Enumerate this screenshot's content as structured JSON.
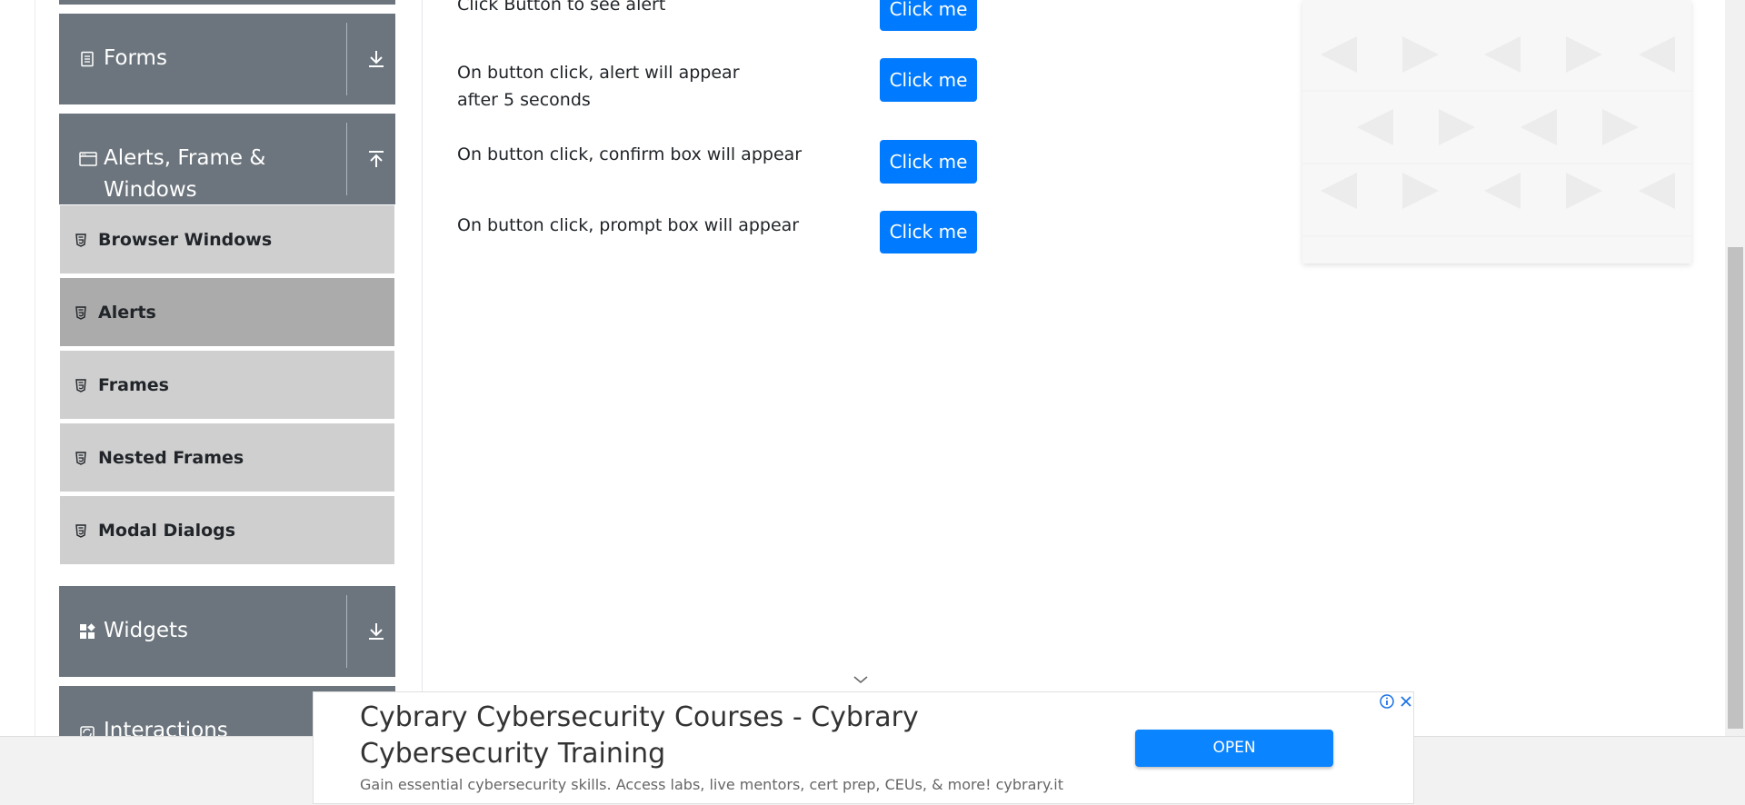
{
  "sidebar": {
    "groups": [
      {
        "label": "Forms",
        "icon": "document-icon",
        "toggle": "download-arrow-icon"
      },
      {
        "label": "Alerts, Frame & Windows",
        "icon": "window-icon",
        "toggle": "upload-arrow-icon"
      },
      {
        "label": "Widgets",
        "icon": "widgets-grid-icon",
        "toggle": "download-arrow-icon"
      },
      {
        "label": "Interactions",
        "icon": "interactions-icon"
      }
    ],
    "items": [
      {
        "label": "Browser Windows",
        "icon": "html5-icon"
      },
      {
        "label": "Alerts",
        "icon": "html5-icon",
        "active": true
      },
      {
        "label": "Frames",
        "icon": "html5-icon"
      },
      {
        "label": "Nested Frames",
        "icon": "html5-icon"
      },
      {
        "label": "Modal Dialogs",
        "icon": "html5-icon"
      }
    ]
  },
  "main": {
    "rows": [
      {
        "text": "Click Button to see alert",
        "button": "Click me"
      },
      {
        "text": "On button click, alert will appear after 5 seconds",
        "button": "Click me"
      },
      {
        "text": "On button click, confirm box will appear",
        "button": "Click me"
      },
      {
        "text": "On button click, prompt box will appear",
        "button": "Click me"
      }
    ]
  },
  "ad": {
    "title": "Cybrary Cybersecurity Courses - Cybrary Cybersecurity Training",
    "description": "Gain essential cybersecurity skills. Access labs, live mentors, cert prep, CEUs, & more! cybrary.it",
    "cta": "OPEN"
  },
  "colors": {
    "sidebar_header": "#6c757d",
    "sidebar_item": "#cfcfcf",
    "sidebar_item_active": "#ababab",
    "primary": "#007bff",
    "ad_button": "#0a84ff"
  }
}
